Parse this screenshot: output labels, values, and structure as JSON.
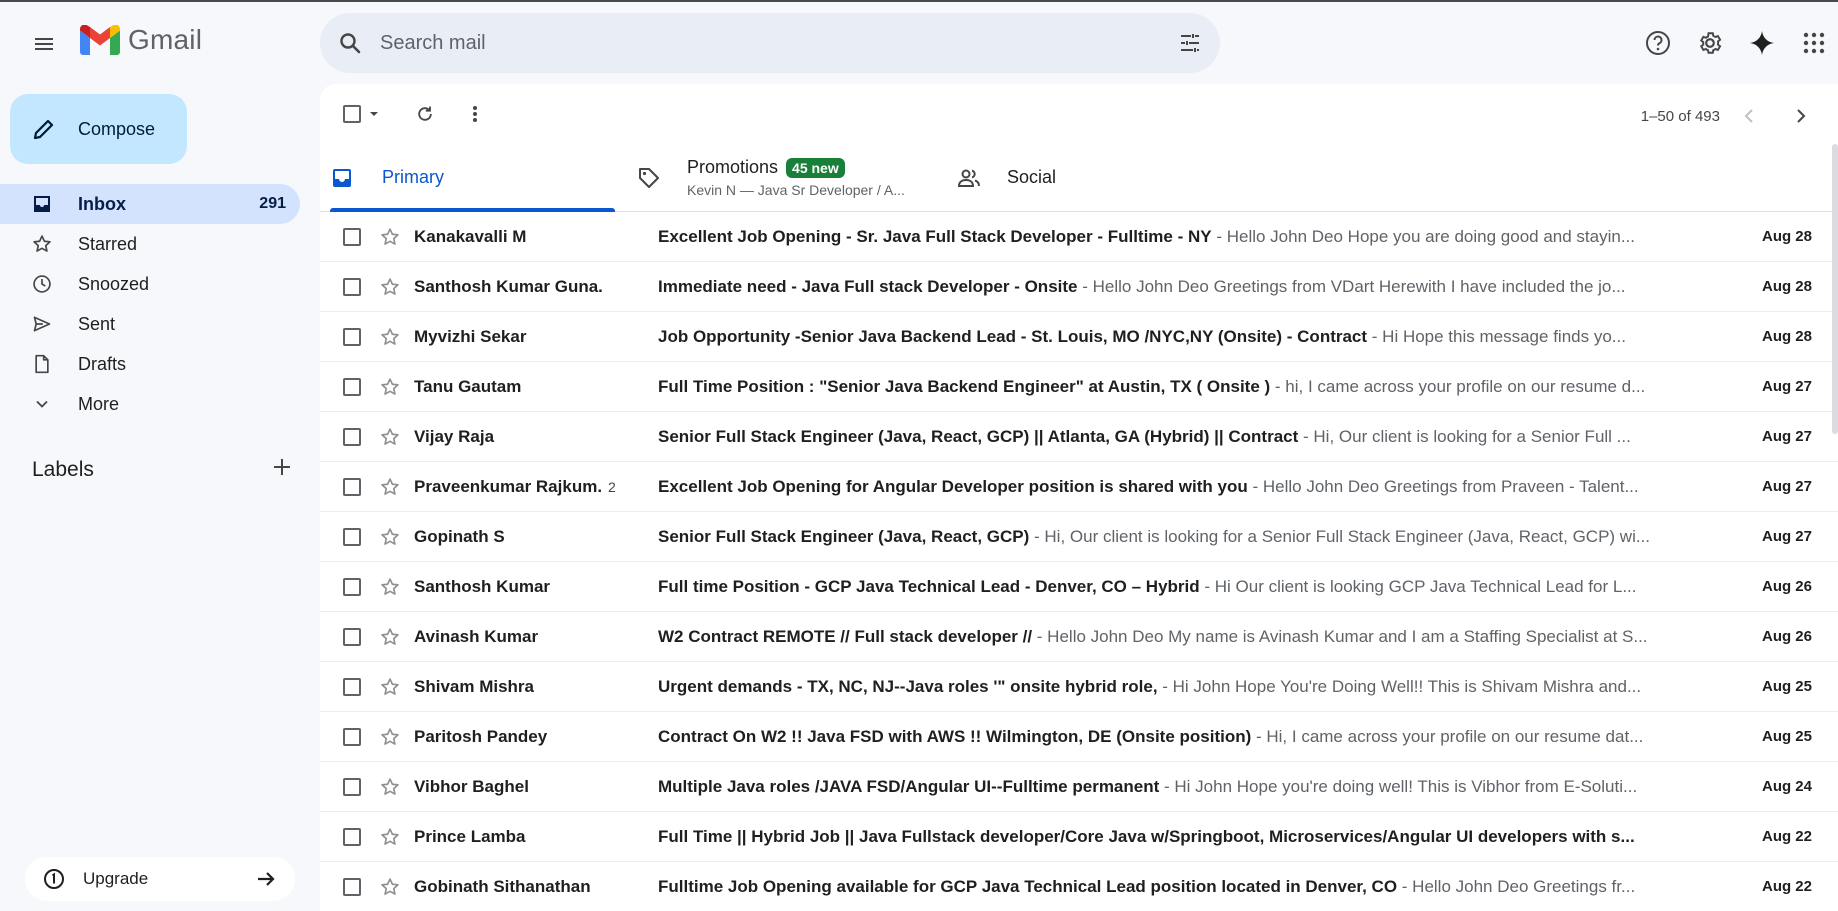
{
  "app": {
    "brand": "Gmail"
  },
  "search": {
    "placeholder": "Search mail"
  },
  "compose": {
    "label": "Compose"
  },
  "sidebar": {
    "items": [
      {
        "label": "Inbox",
        "count": "291",
        "icon": "inbox-icon",
        "active": true
      },
      {
        "label": "Starred",
        "count": "",
        "icon": "star-icon"
      },
      {
        "label": "Snoozed",
        "count": "",
        "icon": "clock-icon"
      },
      {
        "label": "Sent",
        "count": "",
        "icon": "send-icon"
      },
      {
        "label": "Drafts",
        "count": "",
        "icon": "draft-icon"
      },
      {
        "label": "More",
        "count": "",
        "icon": "chevron-down-icon"
      }
    ],
    "labels_heading": "Labels",
    "upgrade_label": "Upgrade"
  },
  "toolbar": {
    "pager_text": "1–50 of 493"
  },
  "tabs": {
    "primary": "Primary",
    "promotions": "Promotions",
    "promotions_badge": "45 new",
    "promotions_sub": "Kevin N — Java Sr Developer / A...",
    "social": "Social"
  },
  "colors": {
    "accent": "#0b57d0",
    "compose_bg": "#c2e7ff",
    "active_nav": "#d3e3fd",
    "badge_green": "#188038"
  },
  "emails": [
    {
      "sender": "Kanakavalli M",
      "count": "",
      "subject": "Excellent Job Opening - Sr. Java Full Stack Developer - Fulltime - NY",
      "snippet": " - Hello John Deo Hope you are doing good and stayin...",
      "date": "Aug 28"
    },
    {
      "sender": "Santhosh Kumar Guna.",
      "count": "",
      "subject": "Immediate need - Java Full stack Developer - Onsite",
      "snippet": " - Hello John Deo Greetings from VDart Herewith I have included the jo...",
      "date": "Aug 28"
    },
    {
      "sender": "Myvizhi Sekar",
      "count": "",
      "subject": "Job Opportunity -Senior Java Backend Lead - St. Louis, MO /NYC,NY (Onsite) - Contract",
      "snippet": " - Hi Hope this message finds yo...",
      "date": "Aug 28"
    },
    {
      "sender": "Tanu Gautam",
      "count": "",
      "subject": "Full Time Position : \"Senior Java Backend Engineer\" at Austin, TX ( Onsite )",
      "snippet": " - hi, I came across your profile on our resume d...",
      "date": "Aug 27"
    },
    {
      "sender": "Vijay Raja",
      "count": "",
      "subject": "Senior Full Stack Engineer (Java, React, GCP) || Atlanta, GA (Hybrid) || Contract",
      "snippet": " - Hi, Our client is looking for a Senior Full ...",
      "date": "Aug 27"
    },
    {
      "sender": "Praveenkumar Rajkum.",
      "count": "2",
      "subject": "Excellent Job Opening for Angular Developer position is shared with you",
      "snippet": " - Hello John Deo Greetings from Praveen - Talent...",
      "date": "Aug 27"
    },
    {
      "sender": "Gopinath S",
      "count": "",
      "subject": "Senior Full Stack Engineer (Java, React, GCP)",
      "snippet": " - Hi, Our client is looking for a Senior Full Stack Engineer (Java, React, GCP) wi...",
      "date": "Aug 27"
    },
    {
      "sender": "Santhosh Kumar",
      "count": "",
      "subject": "Full time Position - GCP Java Technical Lead - Denver, CO – Hybrid",
      "snippet": " - Hi Our client is looking GCP Java Technical Lead for L...",
      "date": "Aug 26"
    },
    {
      "sender": "Avinash Kumar",
      "count": "",
      "subject": "W2 Contract REMOTE // Full stack developer //",
      "snippet": " - Hello John Deo My name is Avinash Kumar and I am a Staffing Specialist at S...",
      "date": "Aug 26"
    },
    {
      "sender": "Shivam Mishra",
      "count": "",
      "subject": "Urgent demands - TX, NC, NJ--Java roles '\" onsite hybrid role,",
      "snippet": " - Hi John Hope You're Doing Well!! This is Shivam Mishra and...",
      "date": "Aug 25"
    },
    {
      "sender": "Paritosh Pandey",
      "count": "",
      "subject": "Contract On W2 !! Java FSD with AWS !! Wilmington, DE (Onsite position)",
      "snippet": " - Hi, I came across your profile on our resume dat...",
      "date": "Aug 25"
    },
    {
      "sender": "Vibhor Baghel",
      "count": "",
      "subject": "Multiple Java roles /JAVA FSD/Angular UI--Fulltime permanent",
      "snippet": " - Hi John Hope you're doing well! This is Vibhor from E-Soluti...",
      "date": "Aug 24"
    },
    {
      "sender": "Prince Lamba",
      "count": "",
      "subject": "Full Time || Hybrid Job || Java Fullstack developer/Core Java w/Springboot, Microservices/Angular UI developers with s...",
      "snippet": "",
      "date": "Aug 22"
    },
    {
      "sender": "Gobinath Sithanathan",
      "count": "",
      "subject": "Fulltime Job Opening available for GCP Java Technical Lead position located in Denver, CO",
      "snippet": " - Hello John Deo Greetings fr...",
      "date": "Aug 22"
    }
  ]
}
